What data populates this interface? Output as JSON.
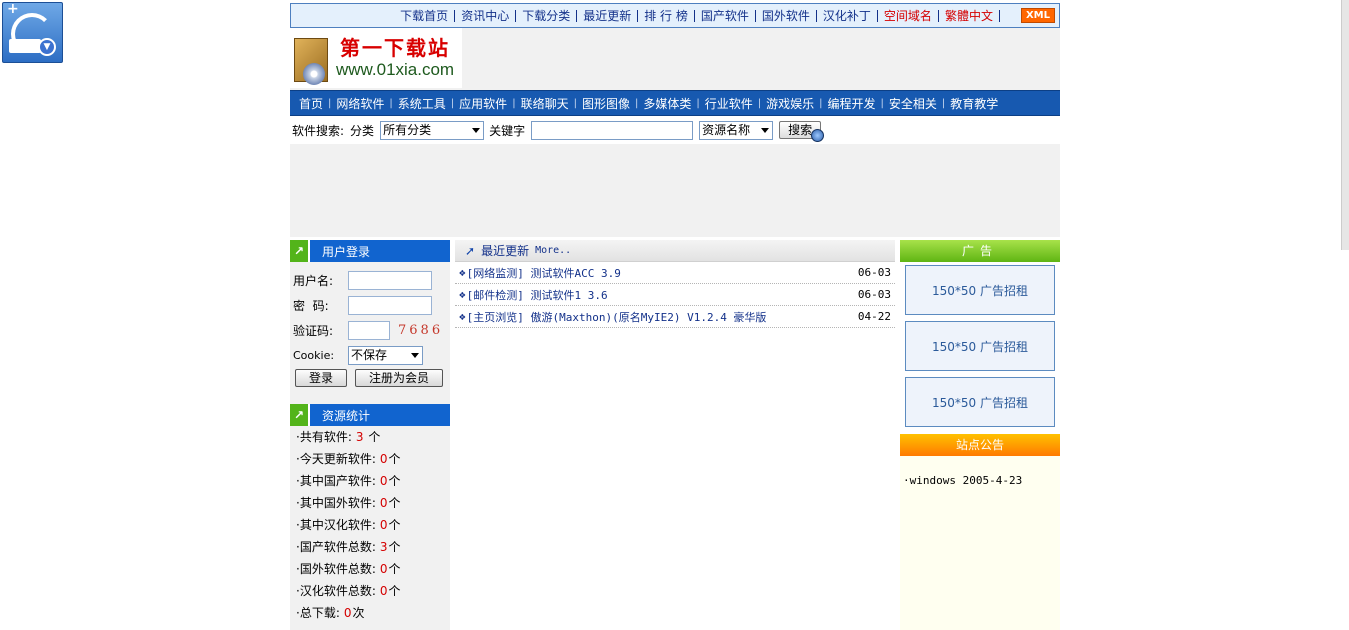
{
  "top_links": [
    "下载首页",
    "资讯中心",
    "下载分类",
    "最近更新",
    "排 行 榜",
    "国产软件",
    "国外软件",
    "汉化补丁",
    "空间域名",
    "繁體中文",
    ""
  ],
  "top_links_red": [
    "空间域名",
    "繁體中文"
  ],
  "xml_badge": "XML",
  "logo": {
    "title": "第一下载站",
    "url": "www.01xia.com"
  },
  "main_nav": [
    "首页",
    "网络软件",
    "系统工具",
    "应用软件",
    "联络聊天",
    "图形图像",
    "多媒体类",
    "行业软件",
    "游戏娱乐",
    "编程开发",
    "安全相关",
    "教育教学"
  ],
  "search": {
    "label": "软件搜索:",
    "category_label": "分类",
    "category_value": "所有分类",
    "keyword_label": "关键字",
    "keyword_value": "",
    "field_value": "资源名称",
    "button_label": "搜索"
  },
  "login": {
    "heading": "用户登录",
    "username_label": "用户名:",
    "username_value": "",
    "password_label": "密  码:",
    "password_value": "",
    "captcha_label": "验证码:",
    "captcha_value": "",
    "captcha_code": "7686",
    "cookie_label": "Cookie:",
    "cookie_value": "不保存",
    "login_button": "登录",
    "register_button": "注册为会员"
  },
  "stats": {
    "heading": "资源统计",
    "rows": [
      {
        "label": "·共有软件:",
        "value": "3",
        "unit": " 个"
      },
      {
        "label": "·今天更新软件:",
        "value": "0",
        "unit": "个"
      },
      {
        "label": "·其中国产软件:",
        "value": "0",
        "unit": "个"
      },
      {
        "label": "·其中国外软件:",
        "value": "0",
        "unit": "个"
      },
      {
        "label": "·其中汉化软件:",
        "value": "0",
        "unit": "个"
      },
      {
        "label": "·国产软件总数:",
        "value": "3",
        "unit": "个"
      },
      {
        "label": "·国外软件总数:",
        "value": "0",
        "unit": "个"
      },
      {
        "label": "·汉化软件总数:",
        "value": "0",
        "unit": "个"
      },
      {
        "label": "·总下载:",
        "value": "0",
        "unit": "次"
      }
    ]
  },
  "latest": {
    "heading": "最近更新",
    "more": "More..",
    "items": [
      {
        "title": "[网络监测] 测试软件ACC 3.9",
        "date": "06-03"
      },
      {
        "title": "[邮件检测] 测试软件1 3.6",
        "date": "06-03"
      },
      {
        "title": "[主页浏览] 傲游(Maxthon)(原名MyIE2) V1.2.4 豪华版",
        "date": "04-22"
      }
    ]
  },
  "ads": {
    "heading": "广告",
    "boxes": [
      "150*50  广告招租",
      "150*50  广告招租",
      "150*50  广告招租"
    ]
  },
  "notice": {
    "heading": "站点公告",
    "items": [
      "·windows 2005-4-23"
    ]
  },
  "colors": {
    "nav_blue": "#1759b0",
    "box_head": "#1164cf",
    "accent_green": "#53b41a",
    "stat_red": "#d40000"
  }
}
